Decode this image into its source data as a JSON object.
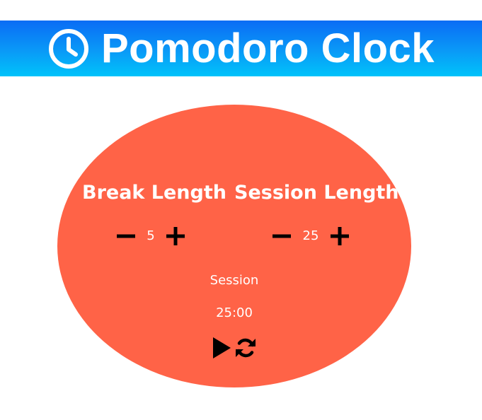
{
  "header": {
    "title": "Pomodoro Clock",
    "icon": "clock-icon",
    "gradient": [
      "#0a6cf5",
      "#00c3fa"
    ]
  },
  "colors": {
    "disc": "#ff6347",
    "text": "#ffffff",
    "icon": "#000000"
  },
  "break": {
    "label": "Break Length",
    "value": "5",
    "decrement_icon": "minus-icon",
    "increment_icon": "plus-icon"
  },
  "session": {
    "label": "Session Length",
    "value": "25",
    "decrement_icon": "minus-icon",
    "increment_icon": "plus-icon"
  },
  "timer": {
    "label": "Session",
    "time_left": "25:00",
    "play_icon": "play-icon",
    "reset_icon": "refresh-icon"
  }
}
